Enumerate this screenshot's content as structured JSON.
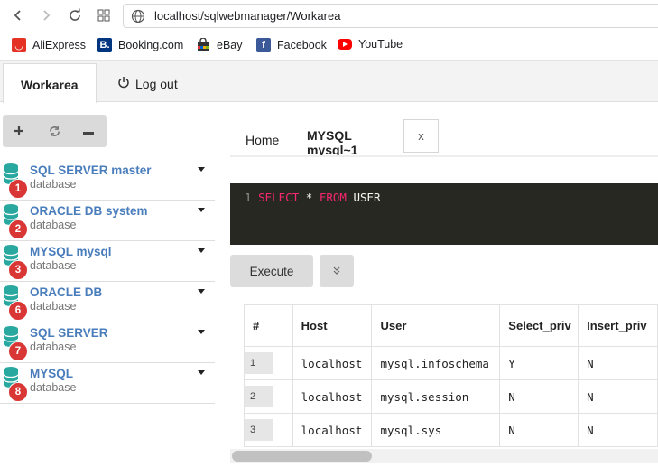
{
  "browser": {
    "url": "localhost/sqlwebmanager/Workarea",
    "bookmarks": [
      {
        "label": "AliExpress",
        "color": "#e43225"
      },
      {
        "label": "Booking.com",
        "color": "#003580"
      },
      {
        "label": "eBay",
        "color": "#333333"
      },
      {
        "label": "Facebook",
        "color": "#3b5998"
      },
      {
        "label": "YouTube",
        "color": "#ff0000"
      }
    ]
  },
  "app_tabs": {
    "workarea": "Workarea",
    "logout": "Log out"
  },
  "sidebar": {
    "toolbar": {
      "add": "+",
      "refresh": "⟳",
      "remove": "—"
    },
    "items": [
      {
        "name": "SQL SERVER master",
        "sub": "database",
        "badge": "1"
      },
      {
        "name": "ORACLE DB system",
        "sub": "database",
        "badge": "2"
      },
      {
        "name": "MYSQL mysql",
        "sub": "database",
        "badge": "3"
      },
      {
        "name": "ORACLE DB",
        "sub": "database",
        "badge": "6"
      },
      {
        "name": "SQL SERVER",
        "sub": "database",
        "badge": "7"
      },
      {
        "name": "MYSQL",
        "sub": "database",
        "badge": "8"
      }
    ]
  },
  "query_tabs": {
    "home": "Home",
    "active": "MYSQL mysql~1",
    "close": "x"
  },
  "editor": {
    "line_no": "1",
    "kw1": "SELECT",
    "star": "*",
    "kw2": "FROM",
    "table": "USER"
  },
  "actions": {
    "execute": "Execute",
    "more": "»"
  },
  "results": {
    "headers": [
      "#",
      "Host",
      "User",
      "Select_priv",
      "Insert_priv"
    ],
    "rows": [
      [
        "1",
        "localhost",
        "mysql.infoschema",
        "Y",
        "N"
      ],
      [
        "2",
        "localhost",
        "mysql.session",
        "N",
        "N"
      ],
      [
        "3",
        "localhost",
        "mysql.sys",
        "N",
        "N"
      ]
    ]
  }
}
